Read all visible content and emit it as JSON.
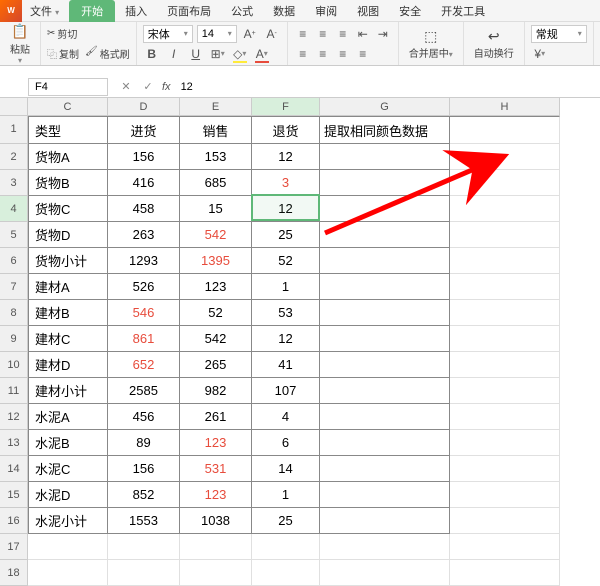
{
  "tabs": {
    "file": "文件",
    "items": [
      "开始",
      "插入",
      "页面布局",
      "公式",
      "数据",
      "审阅",
      "视图",
      "安全",
      "开发工具"
    ],
    "active_index": 0
  },
  "ribbon": {
    "paste": "粘贴",
    "cut": "剪切",
    "copy": "复制",
    "format_painter": "格式刷",
    "font_name": "宋体",
    "font_size": "14",
    "merge_center": "合并居中",
    "wrap_text": "自动换行",
    "number_format": "常规"
  },
  "namebox": "F4",
  "formula_value": "12",
  "columns": [
    "C",
    "D",
    "E",
    "F",
    "G",
    "H"
  ],
  "headers": {
    "C": "类型",
    "D": "进货",
    "E": "销售",
    "F": "退货",
    "G": "提取相同颜色数据"
  },
  "rows": [
    {
      "n": 2,
      "C": "货物A",
      "D": "156",
      "E": "153",
      "F": "12"
    },
    {
      "n": 3,
      "C": "货物B",
      "D": "416",
      "E": "685",
      "F": "3",
      "F_red": true
    },
    {
      "n": 4,
      "C": "货物C",
      "D": "458",
      "E": "15",
      "F": "12",
      "active": true
    },
    {
      "n": 5,
      "C": "货物D",
      "D": "263",
      "E": "542",
      "E_red": true,
      "F": "25"
    },
    {
      "n": 6,
      "C": "货物小计",
      "D": "1293",
      "E": "1395",
      "E_red": true,
      "F": "52",
      "sub": true
    },
    {
      "n": 7,
      "C": "建材A",
      "D": "526",
      "E": "123",
      "F": "1"
    },
    {
      "n": 8,
      "C": "建材B",
      "D": "546",
      "D_red": true,
      "E": "52",
      "F": "53"
    },
    {
      "n": 9,
      "C": "建材C",
      "D": "861",
      "D_red": true,
      "E": "542",
      "F": "12"
    },
    {
      "n": 10,
      "C": "建材D",
      "D": "652",
      "D_red": true,
      "E": "265",
      "F": "41"
    },
    {
      "n": 11,
      "C": "建材小计",
      "D": "2585",
      "E": "982",
      "F": "107",
      "sub": true
    },
    {
      "n": 12,
      "C": "水泥A",
      "D": "456",
      "E": "261",
      "F": "4"
    },
    {
      "n": 13,
      "C": "水泥B",
      "D": "89",
      "E": "123",
      "E_red": true,
      "F": "6"
    },
    {
      "n": 14,
      "C": "水泥C",
      "D": "156",
      "E": "531",
      "E_red": true,
      "F": "14"
    },
    {
      "n": 15,
      "C": "水泥D",
      "D": "852",
      "E": "123",
      "E_red": true,
      "F": "1"
    },
    {
      "n": 16,
      "C": "水泥小计",
      "D": "1553",
      "E": "1038",
      "F": "25",
      "sub": true
    }
  ],
  "blank_rows": [
    17,
    18
  ]
}
